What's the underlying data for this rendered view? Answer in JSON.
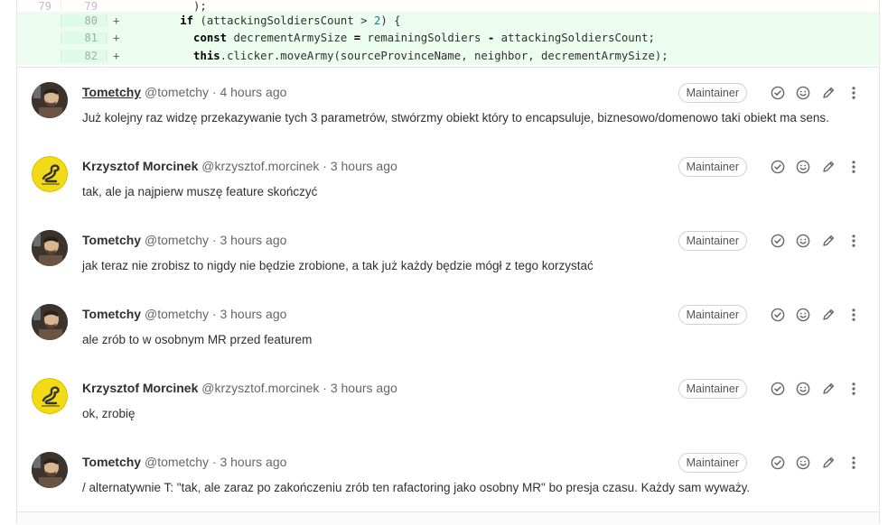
{
  "diff": {
    "lines": [
      {
        "type": "ctx",
        "old": "79",
        "new": "79",
        "sign": "",
        "code": "          );"
      },
      {
        "type": "add",
        "old": "",
        "new": "80",
        "sign": "+",
        "code_parts": [
          {
            "t": "        "
          },
          {
            "t": "if",
            "c": "kw"
          },
          {
            "t": " (attackingSoldiersCount > "
          },
          {
            "t": "2",
            "c": "num"
          },
          {
            "t": ") {"
          }
        ]
      },
      {
        "type": "add",
        "old": "",
        "new": "81",
        "sign": "+",
        "code_parts": [
          {
            "t": "          "
          },
          {
            "t": "const",
            "c": "kw"
          },
          {
            "t": " decrementArmySize "
          },
          {
            "t": "=",
            "c": "op"
          },
          {
            "t": " remainingSoldiers "
          },
          {
            "t": "-",
            "c": "op"
          },
          {
            "t": " attackingSoldiersCount;"
          }
        ]
      },
      {
        "type": "add",
        "old": "",
        "new": "82",
        "sign": "+",
        "code_parts": [
          {
            "t": "          "
          },
          {
            "t": "this",
            "c": "kw"
          },
          {
            "t": ".clicker.moveArmy(sourceProvinceName, neighbor, decrementArmySize);"
          }
        ]
      }
    ]
  },
  "notes": [
    {
      "author": "Tometchy",
      "handle": "@tometchy",
      "time": "4 hours ago",
      "badge": "Maintainer",
      "avatar": "tom",
      "link": true,
      "body": "Już kolejny raz widzę przekazywanie tych 3 parametrów, stwórzmy obiekt który to encapsuluje, biznesowo/domenowo taki obiekt ma sens."
    },
    {
      "author": "Krzysztof Morcinek",
      "handle": "@krzysztof.morcinek",
      "time": "3 hours ago",
      "badge": "Maintainer",
      "avatar": "kmo",
      "link": false,
      "body": "tak, ale ja najpierw muszę feature skończyć"
    },
    {
      "author": "Tometchy",
      "handle": "@tometchy",
      "time": "3 hours ago",
      "badge": "Maintainer",
      "avatar": "tom",
      "link": false,
      "body": "jak teraz nie zrobisz to nigdy nie będzie zrobione, a tak już każdy będzie mógł z tego korzystać"
    },
    {
      "author": "Tometchy",
      "handle": "@tometchy",
      "time": "3 hours ago",
      "badge": "Maintainer",
      "avatar": "tom",
      "link": false,
      "body": "ale zrób to w osobnym MR przed featurem"
    },
    {
      "author": "Krzysztof Morcinek",
      "handle": "@krzysztof.morcinek",
      "time": "3 hours ago",
      "badge": "Maintainer",
      "avatar": "kmo",
      "link": false,
      "body": "ok, zrobię"
    },
    {
      "author": "Tometchy",
      "handle": "@tometchy",
      "time": "3 hours ago",
      "badge": "Maintainer",
      "avatar": "tom",
      "link": false,
      "body": "/ alternatywnie T: \"tak, ale zaraz po zakończeniu zrób ten rafactoring jako osobny MR\" bo presja czasu. Każdy sam wyważy."
    }
  ],
  "icons": {
    "resolve": "check-circle-icon",
    "emoji": "smiley-icon",
    "edit": "pencil-icon",
    "more": "kebab-icon"
  },
  "colors": {
    "added_bg": "#ecfdf0",
    "added_gutter": "#ddfbe6",
    "keyword": "#000000",
    "number": "#1f7c8a"
  }
}
